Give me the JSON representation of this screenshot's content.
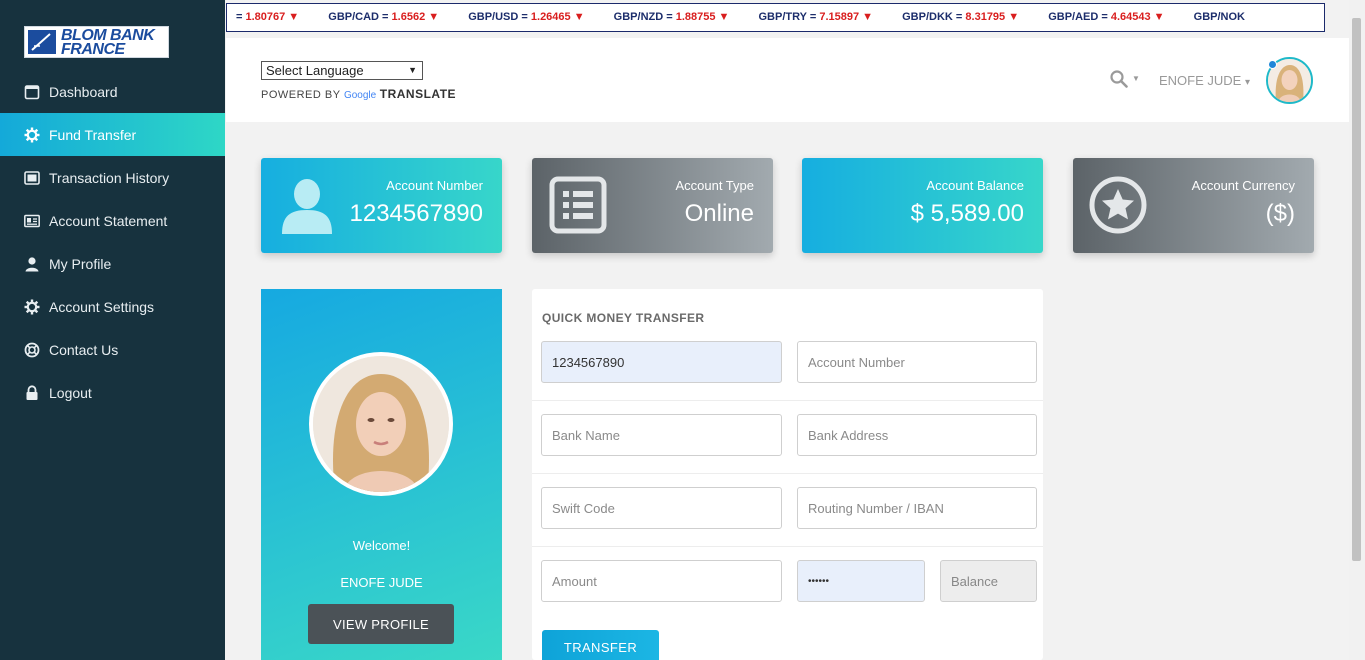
{
  "logo": {
    "line1": "BLOM BANK",
    "line2": "FRANCE"
  },
  "sidebar": {
    "items": [
      {
        "label": "Dashboard",
        "icon": "calendar-icon"
      },
      {
        "label": "Fund Transfer",
        "icon": "gear-icon",
        "active": true
      },
      {
        "label": "Transaction History",
        "icon": "hdd-icon"
      },
      {
        "label": "Account Statement",
        "icon": "id-card-icon"
      },
      {
        "label": "My Profile",
        "icon": "user-icon"
      },
      {
        "label": "Account Settings",
        "icon": "gear-icon"
      },
      {
        "label": "Contact Us",
        "icon": "lifebuoy-icon"
      },
      {
        "label": "Logout",
        "icon": "lock-icon"
      }
    ]
  },
  "ticker": [
    {
      "pair": "",
      "value": "1.80767"
    },
    {
      "pair": "GBP/CAD",
      "value": "1.6562"
    },
    {
      "pair": "GBP/USD",
      "value": "1.26465"
    },
    {
      "pair": "GBP/NZD",
      "value": "1.88755"
    },
    {
      "pair": "GBP/TRY",
      "value": "7.15897"
    },
    {
      "pair": "GBP/DKK",
      "value": "8.31795"
    },
    {
      "pair": "GBP/AED",
      "value": "4.64543"
    },
    {
      "pair": "GBP/NOK",
      "value": ""
    }
  ],
  "header": {
    "language_select": "Select Language",
    "powered_by": "POWERED BY",
    "google": "Google",
    "translate": "TRANSLATE",
    "user_name": "ENOFE JUDE",
    "caret": "▾"
  },
  "cards": [
    {
      "label": "Account Number",
      "value": "1234567890",
      "icon": "user-silhouette-icon",
      "style": "teal"
    },
    {
      "label": "Account Type",
      "value": "Online",
      "icon": "list-alt-icon",
      "style": "grey"
    },
    {
      "label": "Account Balance",
      "value": "$ 5,589.00",
      "icon": "",
      "style": "teal"
    },
    {
      "label": "Account Currency",
      "value": "($)",
      "icon": "star-circle-icon",
      "style": "grey"
    }
  ],
  "profile": {
    "welcome": "Welcome!",
    "name": "ENOFE JUDE",
    "view_profile": "VIEW PROFILE"
  },
  "transfer": {
    "title": "QUICK MONEY TRANSFER",
    "from_account": "1234567890",
    "account_number_placeholder": "Account Number",
    "bank_name_placeholder": "Bank Name",
    "bank_address_placeholder": "Bank Address",
    "swift_placeholder": "Swift Code",
    "routing_placeholder": "Routing Number / IBAN",
    "amount_placeholder": "Amount",
    "pin_value": "••••••",
    "balance_placeholder": "Balance",
    "transfer_button": "TRANSFER"
  },
  "colors": {
    "sidebar_bg": "#17323e",
    "accent_teal": "#2ed7c6",
    "accent_blue": "#14a9d9",
    "card_grey": "#5c6368",
    "ticker_down": "#d91e1e"
  }
}
